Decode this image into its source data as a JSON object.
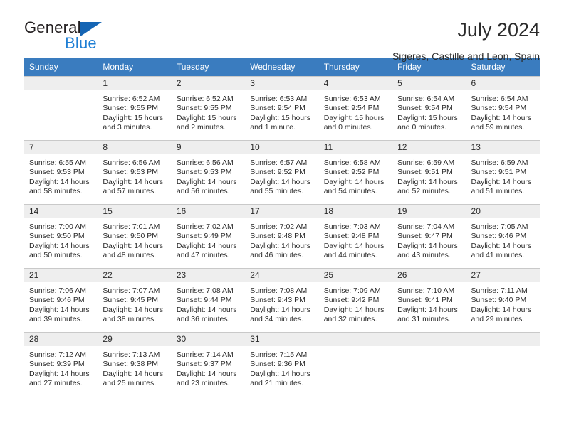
{
  "logo": {
    "word_one": "General",
    "word_two": "Blue",
    "triangle_color": "#1565b4",
    "blue_text_color": "#1f7fd4"
  },
  "header": {
    "title": "July 2024",
    "subtitle": "Sigeres, Castille and Leon, Spain",
    "header_band_color": "#3a7cbf"
  },
  "calendar": {
    "weekday_headers": [
      "Sunday",
      "Monday",
      "Tuesday",
      "Wednesday",
      "Thursday",
      "Friday",
      "Saturday"
    ],
    "weeks": [
      [
        {
          "day": "",
          "sunrise": "",
          "sunset": "",
          "daylight_line1": "",
          "daylight_line2": ""
        },
        {
          "day": "1",
          "sunrise": "Sunrise: 6:52 AM",
          "sunset": "Sunset: 9:55 PM",
          "daylight_line1": "Daylight: 15 hours",
          "daylight_line2": "and 3 minutes."
        },
        {
          "day": "2",
          "sunrise": "Sunrise: 6:52 AM",
          "sunset": "Sunset: 9:55 PM",
          "daylight_line1": "Daylight: 15 hours",
          "daylight_line2": "and 2 minutes."
        },
        {
          "day": "3",
          "sunrise": "Sunrise: 6:53 AM",
          "sunset": "Sunset: 9:54 PM",
          "daylight_line1": "Daylight: 15 hours",
          "daylight_line2": "and 1 minute."
        },
        {
          "day": "4",
          "sunrise": "Sunrise: 6:53 AM",
          "sunset": "Sunset: 9:54 PM",
          "daylight_line1": "Daylight: 15 hours",
          "daylight_line2": "and 0 minutes."
        },
        {
          "day": "5",
          "sunrise": "Sunrise: 6:54 AM",
          "sunset": "Sunset: 9:54 PM",
          "daylight_line1": "Daylight: 15 hours",
          "daylight_line2": "and 0 minutes."
        },
        {
          "day": "6",
          "sunrise": "Sunrise: 6:54 AM",
          "sunset": "Sunset: 9:54 PM",
          "daylight_line1": "Daylight: 14 hours",
          "daylight_line2": "and 59 minutes."
        }
      ],
      [
        {
          "day": "7",
          "sunrise": "Sunrise: 6:55 AM",
          "sunset": "Sunset: 9:53 PM",
          "daylight_line1": "Daylight: 14 hours",
          "daylight_line2": "and 58 minutes."
        },
        {
          "day": "8",
          "sunrise": "Sunrise: 6:56 AM",
          "sunset": "Sunset: 9:53 PM",
          "daylight_line1": "Daylight: 14 hours",
          "daylight_line2": "and 57 minutes."
        },
        {
          "day": "9",
          "sunrise": "Sunrise: 6:56 AM",
          "sunset": "Sunset: 9:53 PM",
          "daylight_line1": "Daylight: 14 hours",
          "daylight_line2": "and 56 minutes."
        },
        {
          "day": "10",
          "sunrise": "Sunrise: 6:57 AM",
          "sunset": "Sunset: 9:52 PM",
          "daylight_line1": "Daylight: 14 hours",
          "daylight_line2": "and 55 minutes."
        },
        {
          "day": "11",
          "sunrise": "Sunrise: 6:58 AM",
          "sunset": "Sunset: 9:52 PM",
          "daylight_line1": "Daylight: 14 hours",
          "daylight_line2": "and 54 minutes."
        },
        {
          "day": "12",
          "sunrise": "Sunrise: 6:59 AM",
          "sunset": "Sunset: 9:51 PM",
          "daylight_line1": "Daylight: 14 hours",
          "daylight_line2": "and 52 minutes."
        },
        {
          "day": "13",
          "sunrise": "Sunrise: 6:59 AM",
          "sunset": "Sunset: 9:51 PM",
          "daylight_line1": "Daylight: 14 hours",
          "daylight_line2": "and 51 minutes."
        }
      ],
      [
        {
          "day": "14",
          "sunrise": "Sunrise: 7:00 AM",
          "sunset": "Sunset: 9:50 PM",
          "daylight_line1": "Daylight: 14 hours",
          "daylight_line2": "and 50 minutes."
        },
        {
          "day": "15",
          "sunrise": "Sunrise: 7:01 AM",
          "sunset": "Sunset: 9:50 PM",
          "daylight_line1": "Daylight: 14 hours",
          "daylight_line2": "and 48 minutes."
        },
        {
          "day": "16",
          "sunrise": "Sunrise: 7:02 AM",
          "sunset": "Sunset: 9:49 PM",
          "daylight_line1": "Daylight: 14 hours",
          "daylight_line2": "and 47 minutes."
        },
        {
          "day": "17",
          "sunrise": "Sunrise: 7:02 AM",
          "sunset": "Sunset: 9:48 PM",
          "daylight_line1": "Daylight: 14 hours",
          "daylight_line2": "and 46 minutes."
        },
        {
          "day": "18",
          "sunrise": "Sunrise: 7:03 AM",
          "sunset": "Sunset: 9:48 PM",
          "daylight_line1": "Daylight: 14 hours",
          "daylight_line2": "and 44 minutes."
        },
        {
          "day": "19",
          "sunrise": "Sunrise: 7:04 AM",
          "sunset": "Sunset: 9:47 PM",
          "daylight_line1": "Daylight: 14 hours",
          "daylight_line2": "and 43 minutes."
        },
        {
          "day": "20",
          "sunrise": "Sunrise: 7:05 AM",
          "sunset": "Sunset: 9:46 PM",
          "daylight_line1": "Daylight: 14 hours",
          "daylight_line2": "and 41 minutes."
        }
      ],
      [
        {
          "day": "21",
          "sunrise": "Sunrise: 7:06 AM",
          "sunset": "Sunset: 9:46 PM",
          "daylight_line1": "Daylight: 14 hours",
          "daylight_line2": "and 39 minutes."
        },
        {
          "day": "22",
          "sunrise": "Sunrise: 7:07 AM",
          "sunset": "Sunset: 9:45 PM",
          "daylight_line1": "Daylight: 14 hours",
          "daylight_line2": "and 38 minutes."
        },
        {
          "day": "23",
          "sunrise": "Sunrise: 7:08 AM",
          "sunset": "Sunset: 9:44 PM",
          "daylight_line1": "Daylight: 14 hours",
          "daylight_line2": "and 36 minutes."
        },
        {
          "day": "24",
          "sunrise": "Sunrise: 7:08 AM",
          "sunset": "Sunset: 9:43 PM",
          "daylight_line1": "Daylight: 14 hours",
          "daylight_line2": "and 34 minutes."
        },
        {
          "day": "25",
          "sunrise": "Sunrise: 7:09 AM",
          "sunset": "Sunset: 9:42 PM",
          "daylight_line1": "Daylight: 14 hours",
          "daylight_line2": "and 32 minutes."
        },
        {
          "day": "26",
          "sunrise": "Sunrise: 7:10 AM",
          "sunset": "Sunset: 9:41 PM",
          "daylight_line1": "Daylight: 14 hours",
          "daylight_line2": "and 31 minutes."
        },
        {
          "day": "27",
          "sunrise": "Sunrise: 7:11 AM",
          "sunset": "Sunset: 9:40 PM",
          "daylight_line1": "Daylight: 14 hours",
          "daylight_line2": "and 29 minutes."
        }
      ],
      [
        {
          "day": "28",
          "sunrise": "Sunrise: 7:12 AM",
          "sunset": "Sunset: 9:39 PM",
          "daylight_line1": "Daylight: 14 hours",
          "daylight_line2": "and 27 minutes."
        },
        {
          "day": "29",
          "sunrise": "Sunrise: 7:13 AM",
          "sunset": "Sunset: 9:38 PM",
          "daylight_line1": "Daylight: 14 hours",
          "daylight_line2": "and 25 minutes."
        },
        {
          "day": "30",
          "sunrise": "Sunrise: 7:14 AM",
          "sunset": "Sunset: 9:37 PM",
          "daylight_line1": "Daylight: 14 hours",
          "daylight_line2": "and 23 minutes."
        },
        {
          "day": "31",
          "sunrise": "Sunrise: 7:15 AM",
          "sunset": "Sunset: 9:36 PM",
          "daylight_line1": "Daylight: 14 hours",
          "daylight_line2": "and 21 minutes."
        },
        {
          "day": "",
          "sunrise": "",
          "sunset": "",
          "daylight_line1": "",
          "daylight_line2": ""
        },
        {
          "day": "",
          "sunrise": "",
          "sunset": "",
          "daylight_line1": "",
          "daylight_line2": ""
        },
        {
          "day": "",
          "sunrise": "",
          "sunset": "",
          "daylight_line1": "",
          "daylight_line2": ""
        }
      ]
    ]
  }
}
